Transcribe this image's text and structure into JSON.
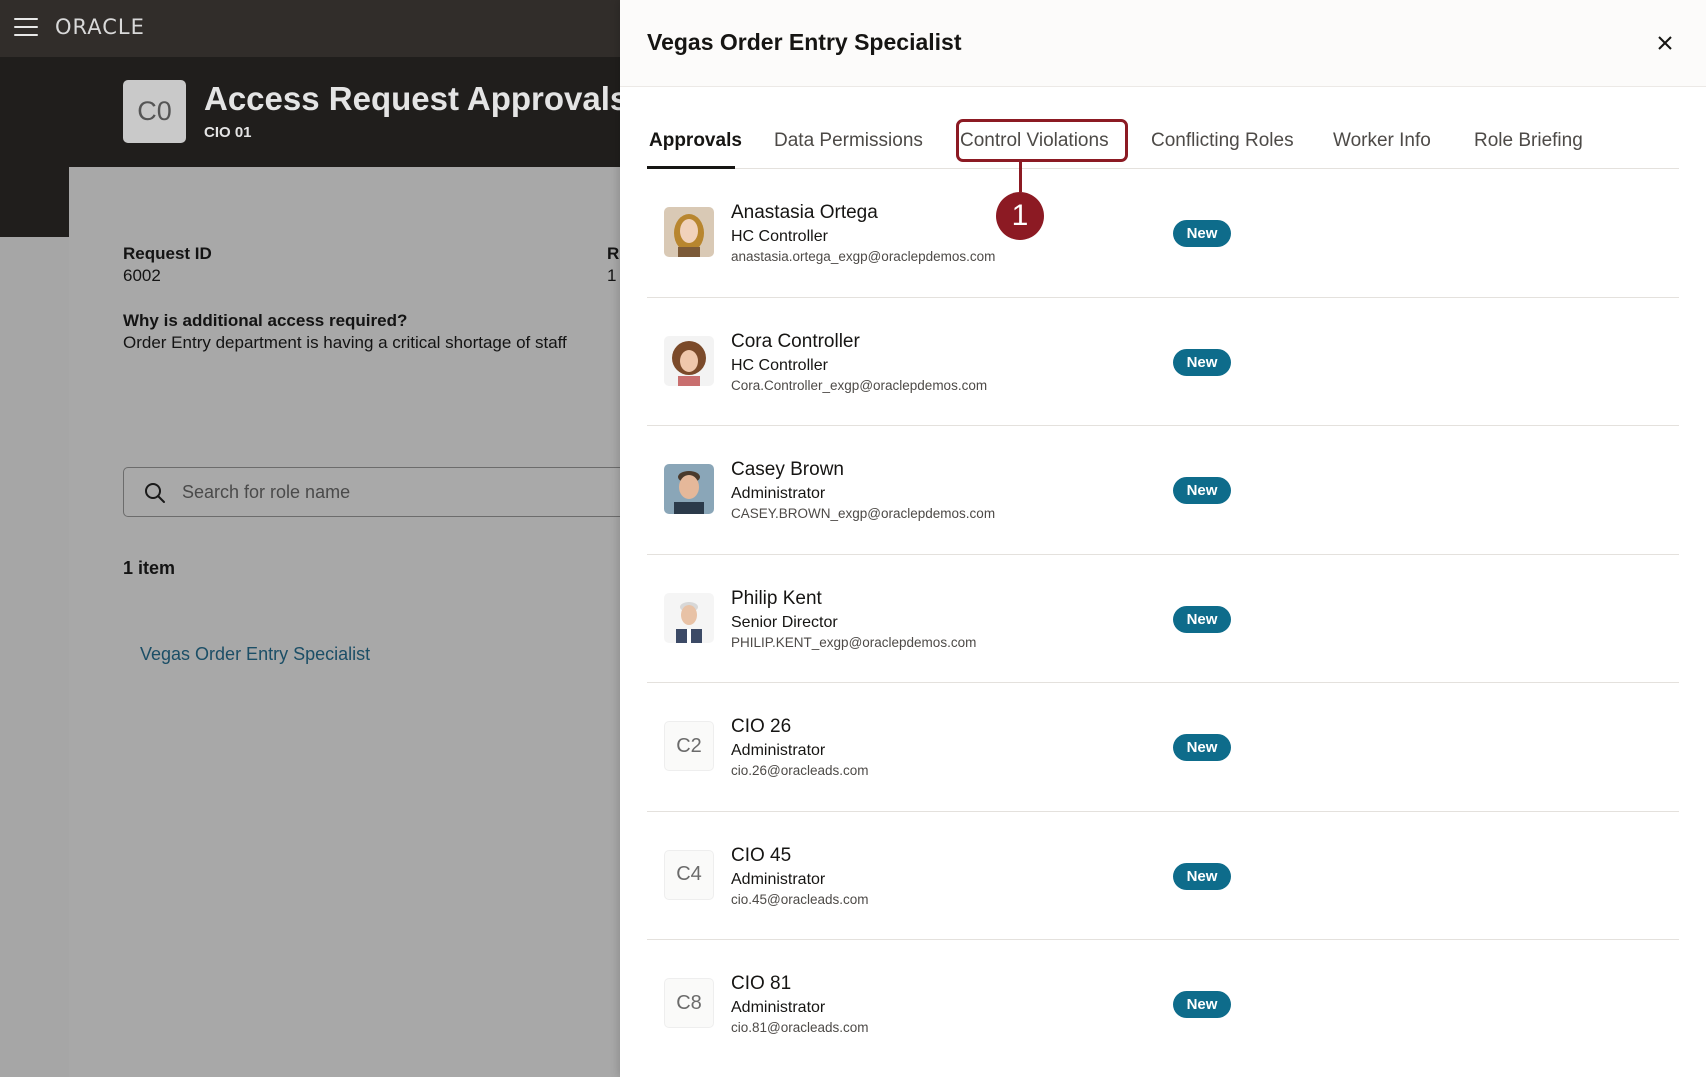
{
  "app": {
    "logo_text": "ORACLE",
    "page_title": "Access Request Approvals",
    "page_subtitle": "CIO 01",
    "avatar_initials": "C0"
  },
  "request": {
    "id_label": "Request ID",
    "id_value": "6002",
    "second_label_partial": "R",
    "second_value_partial": "1",
    "reason_label": "Why is additional access required?",
    "reason_value": "Order Entry department is having a critical shortage of staff"
  },
  "search": {
    "placeholder": "Search for role name",
    "icon": "search-icon"
  },
  "results": {
    "count_text": "1 item",
    "items": [
      "Vegas Order Entry Specialist"
    ]
  },
  "drawer": {
    "title": "Vegas Order Entry Specialist",
    "close_icon": "close-icon",
    "tabs": [
      {
        "label": "Approvals",
        "active": true
      },
      {
        "label": "Data Permissions",
        "active": false
      },
      {
        "label": "Control Violations",
        "active": false
      },
      {
        "label": "Conflicting Roles",
        "active": false
      },
      {
        "label": "Worker Info",
        "active": false
      },
      {
        "label": "Role Briefing",
        "active": false
      }
    ],
    "callout_number": "1",
    "callout_color": "#8c1a23",
    "badge_color": "#0e6c8b",
    "approvers": [
      {
        "name": "Anastasia Ortega",
        "role": "HC Controller",
        "email": "anastasia.ortega_exgp@oraclepdemos.com",
        "status": "New",
        "avatar": "photo"
      },
      {
        "name": "Cora Controller",
        "role": "HC Controller",
        "email": "Cora.Controller_exgp@oraclepdemos.com",
        "status": "New",
        "avatar": "photo"
      },
      {
        "name": "Casey Brown",
        "role": "Administrator",
        "email": "CASEY.BROWN_exgp@oraclepdemos.com",
        "status": "New",
        "avatar": "photo"
      },
      {
        "name": "Philip Kent",
        "role": "Senior Director",
        "email": "PHILIP.KENT_exgp@oraclepdemos.com",
        "status": "New",
        "avatar": "photo"
      },
      {
        "name": "CIO 26",
        "role": "Administrator",
        "email": "cio.26@oracleads.com",
        "status": "New",
        "avatar": "C2"
      },
      {
        "name": "CIO 45",
        "role": "Administrator",
        "email": "cio.45@oracleads.com",
        "status": "New",
        "avatar": "C4"
      },
      {
        "name": "CIO 81",
        "role": "Administrator",
        "email": "cio.81@oracleads.com",
        "status": "New",
        "avatar": "C8"
      }
    ]
  }
}
